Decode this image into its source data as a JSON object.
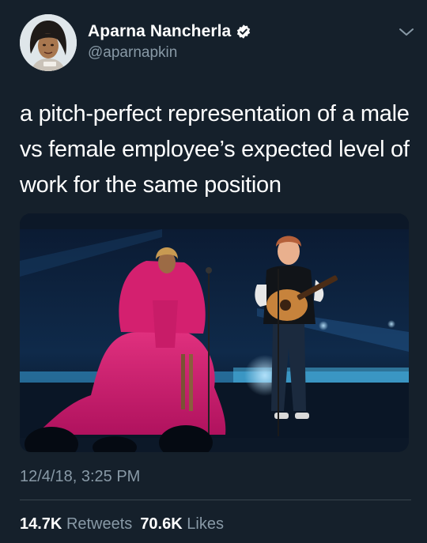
{
  "tweet": {
    "author": {
      "display_name": "Aparna Nancherla",
      "handle": "@aparnapkin",
      "verified_icon": "verified-badge-icon",
      "avatar_icon": "avatar-portrait"
    },
    "text": "a pitch-perfect representation of a male vs female employee’s expected level of work for the same position",
    "timestamp": "12/4/18, 3:25 PM",
    "stats": {
      "retweets_count": "14.7K",
      "retweets_label": "Retweets",
      "likes_count": "70.6K",
      "likes_label": "Likes"
    },
    "menu_icon": "chevron-down-icon"
  },
  "colors": {
    "background": "#15202b",
    "secondary_text": "#8899a6",
    "divider": "#38444d",
    "verified": "#ffffff"
  }
}
